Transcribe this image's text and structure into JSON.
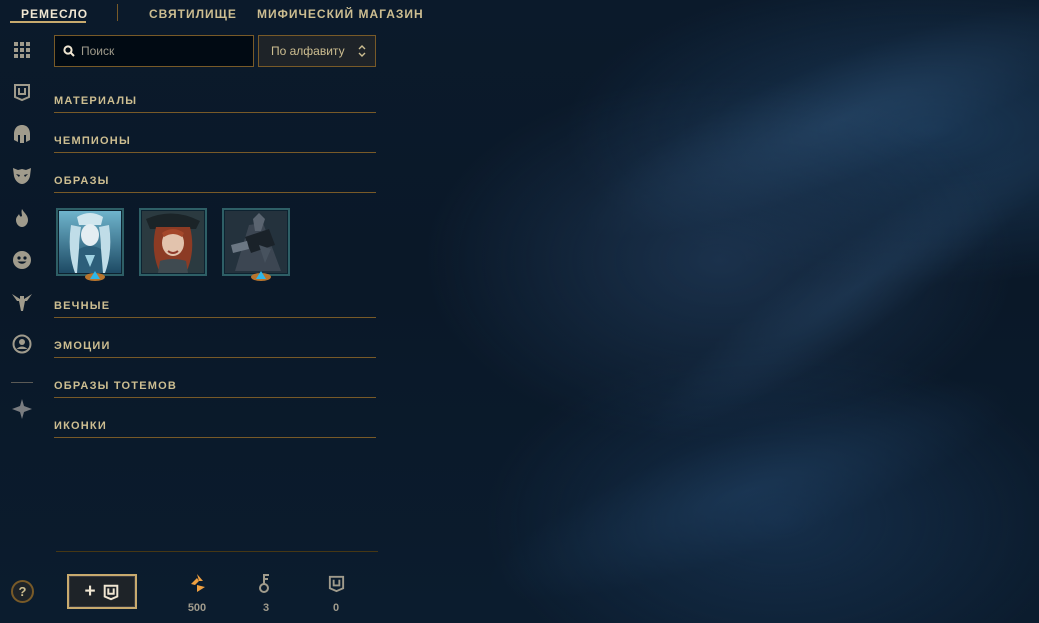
{
  "topnav": {
    "tabs": [
      {
        "label": "РЕМЕСЛО",
        "active": true
      },
      {
        "label": "СВЯТИЛИЩЕ",
        "active": false
      },
      {
        "label": "МИФИЧЕСКИЙ МАГАЗИН",
        "active": false
      }
    ]
  },
  "rail": {
    "icons": [
      "grid-icon",
      "chest-icon",
      "helmet-icon",
      "mask-icon",
      "flame-icon",
      "emote-face-icon",
      "ward-totem-icon",
      "profile-icon",
      "crest-icon"
    ],
    "help_label": "?"
  },
  "search": {
    "placeholder": "Поиск",
    "value": ""
  },
  "sort": {
    "selected": "По алфавиту"
  },
  "categories": [
    {
      "label": "МАТЕРИАЛЫ"
    },
    {
      "label": "ЧЕМПИОНЫ"
    },
    {
      "label": "ОБРАЗЫ"
    },
    {
      "label": "ВЕЧНЫЕ"
    },
    {
      "label": "ЭМОЦИИ"
    },
    {
      "label": "ОБРАЗЫ ТОТЕМОВ"
    },
    {
      "label": "ИКОНКИ"
    }
  ],
  "skins": [
    {
      "name": "skin-shard-1",
      "badge": "rarity-badge"
    },
    {
      "name": "skin-shard-2",
      "badge": "rarity-badge"
    },
    {
      "name": "skin-shard-3",
      "badge": "rarity-badge"
    }
  ],
  "bottom": {
    "add_label": "+",
    "currencies": [
      {
        "icon": "orange-essence-icon",
        "value": "500",
        "color": "#f0a040"
      },
      {
        "icon": "key-icon",
        "value": "3",
        "color": "#a09b8c"
      },
      {
        "icon": "chest-icon",
        "value": "0",
        "color": "#a09b8c"
      }
    ]
  },
  "colors": {
    "gold": "#c8aa6e",
    "gold_dark": "#785a28",
    "text": "#cdbe91",
    "background": "#0a1828",
    "accent_blue": "#0ac8b9"
  }
}
